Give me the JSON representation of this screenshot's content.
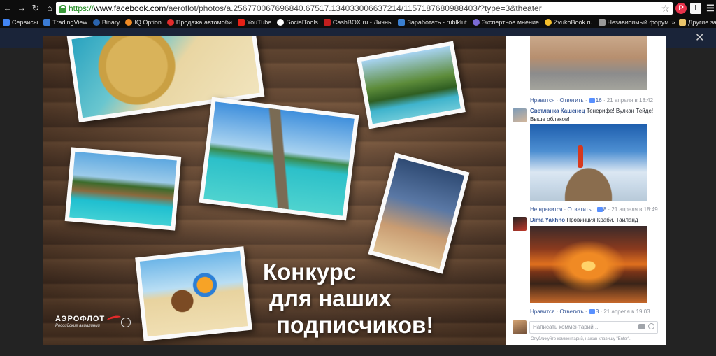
{
  "browser": {
    "url_scheme": "https://",
    "url_domain": "www.facebook.com",
    "url_path": "/aeroflot/photos/a.256770067696840.67517.134033006637214/1157187680988403/?type=3&theater"
  },
  "bookmarks": [
    {
      "label": "Сервисы",
      "color": "#4285f4"
    },
    {
      "label": "TradingView",
      "color": "#3b7cd6"
    },
    {
      "label": "Binary",
      "color": "#2a64b0"
    },
    {
      "label": "IQ Option",
      "color": "#f08a24"
    },
    {
      "label": "Продажа автомоби",
      "color": "#e02b2b"
    },
    {
      "label": "YouTube",
      "color": "#e62117"
    },
    {
      "label": "SocialTools",
      "color": "#ffffff"
    },
    {
      "label": "CashBOX.ru - Личны",
      "color": "#c21e1e"
    },
    {
      "label": "Заработать - rublklut",
      "color": "#3a7fd0"
    },
    {
      "label": "Экспертное мнение",
      "color": "#7a6ad6"
    },
    {
      "label": "ZvukoBook.ru",
      "color": "#f6c02c"
    },
    {
      "label": "Независимый форум",
      "color": "#999999"
    }
  ],
  "bookmarks_other": "Другие закладки",
  "photo": {
    "caption_lines": [
      "Конкурс",
      "для наших",
      "подписчиков!"
    ],
    "brand": "АЭРОФЛОТ",
    "brand_sub": "Российские авиалинии"
  },
  "comments": [
    {
      "like_label": "Нравится",
      "reply_label": "Ответить",
      "likes": "16",
      "time": "21 апреля в 18:42"
    },
    {
      "author": "Светланка Кашенец",
      "text": "Тенерифе! Вулкан Тейде! Выше облаков!",
      "like_label": "Не нравится",
      "reply_label": "Ответить",
      "likes": "8",
      "time": "21 апреля в 18:49"
    },
    {
      "author": "Dima Yakhno",
      "text": "Провинция Краби, Таиланд",
      "like_label": "Нравится",
      "reply_label": "Ответить",
      "likes": "8",
      "time": "21 апреля в 19:03"
    }
  ],
  "comment_box": {
    "placeholder": "Написать комментарий ...",
    "hint": "Опубликуйте комментарий, нажав клавишу \"Enter\"."
  }
}
